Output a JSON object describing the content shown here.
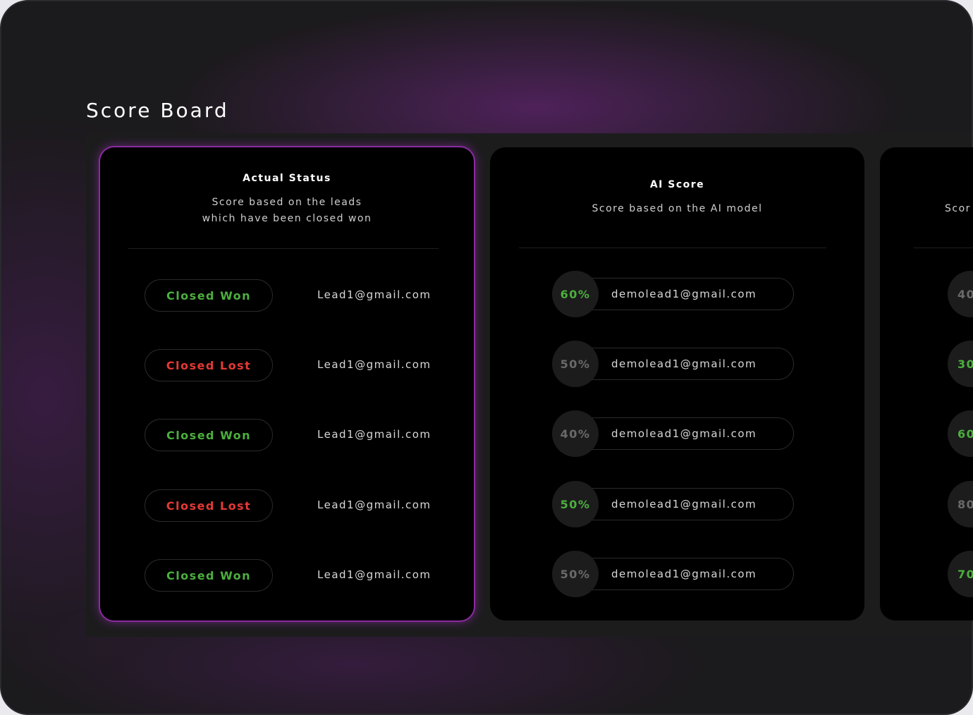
{
  "title": "Score Board",
  "colors": {
    "won": "#4caf3e",
    "lost": "#e53935",
    "muted": "#6a6a6a",
    "accent": "#8a2ba0"
  },
  "actual": {
    "title": "Actual Status",
    "subtitle1": "Score based on the leads",
    "subtitle2": "which have been closed won",
    "rows": [
      {
        "status": "Closed Won",
        "type": "won",
        "email": "Lead1@gmail.com"
      },
      {
        "status": "Closed Lost",
        "type": "lost",
        "email": "Lead1@gmail.com"
      },
      {
        "status": "Closed Won",
        "type": "won",
        "email": "Lead1@gmail.com"
      },
      {
        "status": "Closed Lost",
        "type": "lost",
        "email": "Lead1@gmail.com"
      },
      {
        "status": "Closed Won",
        "type": "won",
        "email": "Lead1@gmail.com"
      }
    ]
  },
  "ai": {
    "title": "AI Score",
    "subtitle": "Score based on the AI model",
    "rows": [
      {
        "score": "60%",
        "highlight": true,
        "email": "demolead1@gmail.com"
      },
      {
        "score": "50%",
        "highlight": false,
        "email": "demolead1@gmail.com"
      },
      {
        "score": "40%",
        "highlight": false,
        "email": "demolead1@gmail.com"
      },
      {
        "score": "50%",
        "highlight": true,
        "email": "demolead1@gmail.com"
      },
      {
        "score": "50%",
        "highlight": false,
        "email": "demolead1@gmail.com"
      }
    ]
  },
  "third": {
    "subtitle": "Scor",
    "rows": [
      {
        "score": "40",
        "highlight": false
      },
      {
        "score": "30",
        "highlight": true
      },
      {
        "score": "60",
        "highlight": true
      },
      {
        "score": "80",
        "highlight": false
      },
      {
        "score": "70",
        "highlight": true
      }
    ]
  }
}
